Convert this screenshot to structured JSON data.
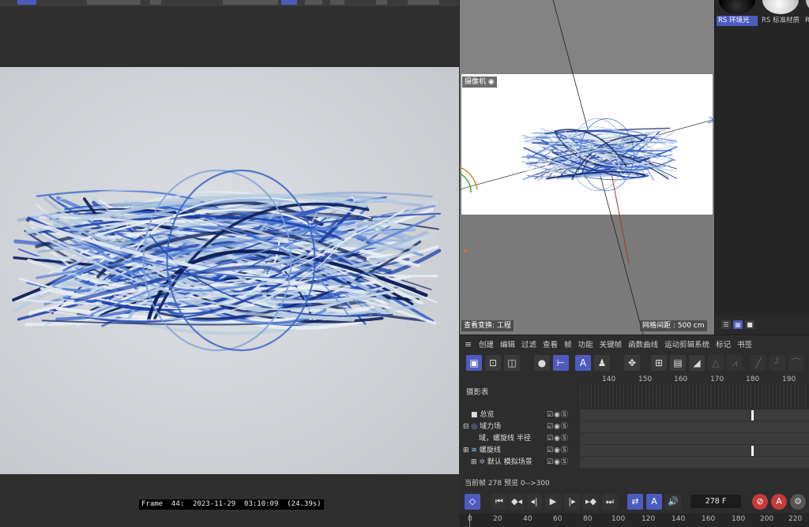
{
  "render": {
    "status_line": "Frame  44:  2023-11-29  03:10:09  (24.39s)"
  },
  "viewport": {
    "camera_label": "摄像机",
    "view_transform": "查看变换: 工程",
    "grid_spacing": "网格间距 : 500 cm"
  },
  "materials": [
    {
      "label": "RS 环境光",
      "selected": true
    },
    {
      "label": "RS 标准材质",
      "selected": false
    },
    {
      "label": "R",
      "selected": false
    }
  ],
  "timeline": {
    "menu_icon": "hamburger-icon",
    "menu": [
      "创建",
      "编辑",
      "过滤",
      "查看",
      "帧",
      "功能",
      "关键帧",
      "函数曲线",
      "运动剪辑系统",
      "标记",
      "书签"
    ],
    "panel_title": "摄影表",
    "ruler": [
      "140",
      "150",
      "160",
      "170",
      "180",
      "190"
    ],
    "tracks": [
      {
        "label": "总览",
        "indent": 0
      },
      {
        "label": "域力场",
        "indent": 1
      },
      {
        "label": "域，螺旋线 半径",
        "indent": 2
      },
      {
        "label": "螺旋线",
        "indent": 1
      },
      {
        "label": "默认 模拟场景",
        "indent": 1
      }
    ],
    "track_icons": "☑◉Ⓢ",
    "info_current_label": "当前帧",
    "info_current_value": "278",
    "info_preview_label": "预览",
    "info_preview_value": "0-->300",
    "frame_value": "278 F",
    "bottom_ruler": [
      "0",
      "20",
      "40",
      "60",
      "80",
      "100",
      "120",
      "140",
      "160",
      "180",
      "200",
      "220"
    ]
  },
  "colors": {
    "accent": "#4d5bbf",
    "record": "#c53b3b",
    "strand_dark": "#1c3fa8",
    "strand_light": "#e8eef4"
  }
}
